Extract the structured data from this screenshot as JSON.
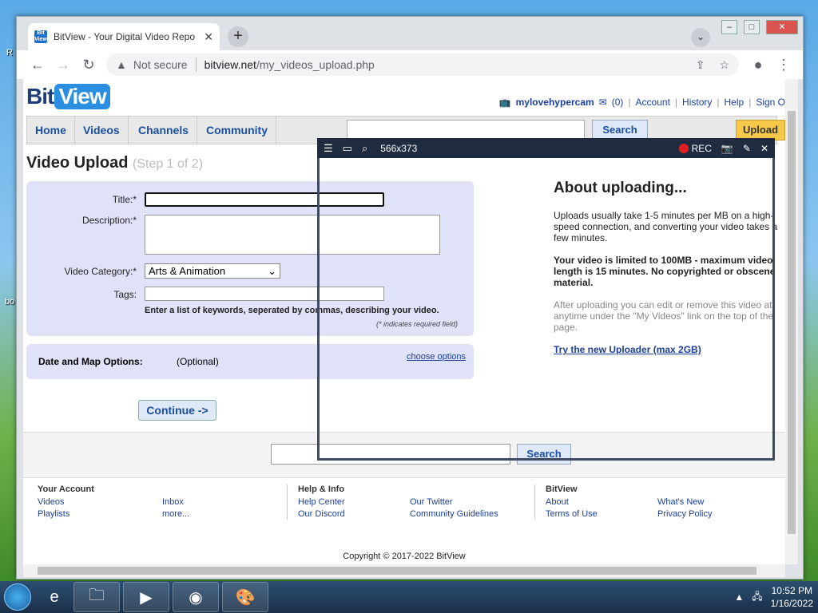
{
  "browser": {
    "tab_title": "BitView - Your Digital Video Repo",
    "tab_favicon": "Bit View",
    "url_security": "Not secure",
    "url_domain": "bitview.net",
    "url_path": "/my_videos_upload.php"
  },
  "site": {
    "logo_bit": "Bit",
    "logo_view": "View",
    "username": "mylovehypercam",
    "inbox_count": "(0)",
    "links": [
      "Account",
      "History",
      "Help",
      "Sign O"
    ],
    "nav": [
      "Home",
      "Videos",
      "Channels",
      "Community"
    ],
    "search_btn": "Search",
    "upload_btn": "Upload"
  },
  "upload": {
    "title": "Video Upload",
    "step": "(Step 1 of 2)",
    "title_label": "Title:*",
    "desc_label": "Description:*",
    "category_label": "Video Category:*",
    "category_value": "Arts & Animation",
    "tags_label": "Tags:",
    "tags_hint": "Enter a list of keywords, seperated by commas, describing your video.",
    "required_note": "(* indicates required field)",
    "date_label": "Date and Map Options:",
    "date_optional": "(Optional)",
    "choose_options": "choose options",
    "continue": "Continue ->"
  },
  "about": {
    "heading": "About uploading...",
    "p1": "Uploads usually take 1-5 minutes per MB on a high-speed connection, and converting your video takes a few minutes.",
    "p2": "Your video is limited to 100MB - maximum video length is 15 minutes. No copyrighted or obscene material.",
    "p3": "After uploading you can edit or remove this video at anytime under the \"My Videos\" link on the top of the page.",
    "link": "Try the new Uploader (max 2GB)"
  },
  "footer": {
    "search_btn": "Search",
    "account_head": "Your Account",
    "account_col1": [
      "Videos",
      "Playlists"
    ],
    "account_col2": [
      "Inbox",
      "more..."
    ],
    "help_head": "Help & Info",
    "help_col1": [
      "Help Center",
      "Our Discord"
    ],
    "help_col2": [
      "Our Twitter",
      "Community Guidelines"
    ],
    "bv_head": "BitView",
    "bv_col1": [
      "About",
      "Terms of Use"
    ],
    "bv_col2": [
      "What's New",
      "Privacy Policy"
    ],
    "copyright": "Copyright © 2017-2022 BitView"
  },
  "recorder": {
    "dimensions": "566x373",
    "rec_label": "REC"
  },
  "taskbar": {
    "time": "10:52 PM",
    "date": "1/16/2022"
  }
}
